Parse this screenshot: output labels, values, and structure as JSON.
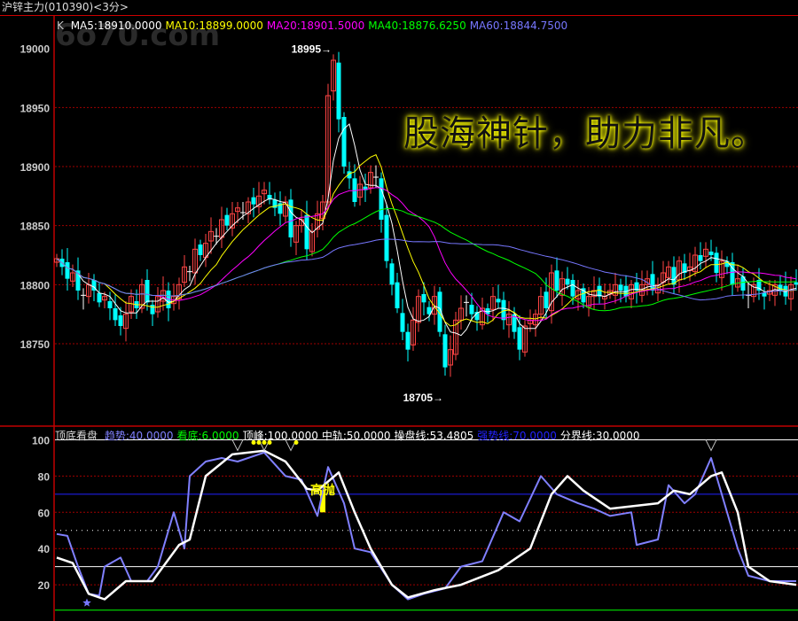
{
  "title": "沪锌主力(010390)<3分>",
  "watermark": "6o70.com",
  "main_header": {
    "k": "K",
    "items": [
      {
        "label": "MA5:18910.0000",
        "color": "#ffffff"
      },
      {
        "label": "MA10:18899.0000",
        "color": "#ffff00"
      },
      {
        "label": "MA20:18901.5000",
        "color": "#ff00ff"
      },
      {
        "label": "MA40:18876.6250",
        "color": "#00ff00"
      },
      {
        "label": "MA60:18844.7500",
        "color": "#7777ff"
      }
    ]
  },
  "price_axis": {
    "ticks": [
      "19000",
      "18950",
      "18900",
      "18850",
      "18800",
      "18750"
    ],
    "values": [
      19000,
      18950,
      18900,
      18850,
      18800,
      18750
    ],
    "range": [
      18681,
      19026
    ]
  },
  "annotations": {
    "high": "18995→",
    "high_value": 18995,
    "high_index": 52,
    "low": "18705→",
    "low_value": 18705,
    "low_index": 73
  },
  "slogan": "股海神针，助力非凡。",
  "colors": {
    "up": "#ff4444",
    "down": "#00ffff",
    "doji": "#ffffff",
    "grid": "#a00000",
    "axis": "#c00000"
  },
  "closes": [
    18822,
    18815,
    18805,
    18810,
    18795,
    18790,
    18800,
    18795,
    18785,
    18790,
    18780,
    18770,
    18765,
    18775,
    18790,
    18780,
    18800,
    18785,
    18775,
    18790,
    18795,
    18780,
    18790,
    18800,
    18815,
    18810,
    18830,
    18825,
    18835,
    18845,
    18840,
    18855,
    18850,
    18860,
    18865,
    18860,
    18870,
    18868,
    18875,
    18880,
    18872,
    18865,
    18860,
    18870,
    18840,
    18850,
    18855,
    18830,
    18845,
    18860,
    18870,
    18960,
    18990,
    18940,
    18900,
    18890,
    18870,
    18885,
    18880,
    18895,
    18890,
    18855,
    18820,
    18800,
    18780,
    18760,
    18745,
    18770,
    18790,
    18785,
    18775,
    18790,
    18760,
    18730,
    18745,
    18770,
    18780,
    18785,
    18775,
    18770,
    18780,
    18775,
    18790,
    18785,
    18770,
    18775,
    18760,
    18745,
    18765,
    18770,
    18775,
    18790,
    18780,
    18810,
    18795,
    18805,
    18800,
    18790,
    18795,
    18785,
    18790,
    18795,
    18790,
    18790,
    18795,
    18800,
    18795,
    18790,
    18800,
    18795,
    18800,
    18805,
    18795,
    18800,
    18810,
    18815,
    18800,
    18820,
    18810,
    18815,
    18825,
    18820,
    18830,
    18825,
    18810,
    18820,
    18815,
    18800,
    18805,
    18795,
    18790,
    18800,
    18795,
    18790,
    18795,
    18800,
    18795,
    18790,
    18800,
    18800
  ],
  "indicator": {
    "name": "顶底看盘",
    "params": [
      {
        "label": "趋势:40.0000",
        "color": "#8080ff"
      },
      {
        "label": "看底:6.0000",
        "color": "#00ff00"
      },
      {
        "label": "顶峰:100.0000",
        "color": "#ffffff"
      },
      {
        "label": "中轨:50.0000",
        "color": "#ffffff"
      },
      {
        "label": "操盘线:53.4805",
        "color": "#ffffff"
      },
      {
        "label": "强势线:70.0000",
        "color": "#2222ff"
      },
      {
        "label": "分界线:30.0000",
        "color": "#ffffff"
      }
    ],
    "ticks": [
      "100",
      "80",
      "60",
      "40",
      "20"
    ],
    "tick_values": [
      100,
      80,
      60,
      40,
      20
    ],
    "range": [
      0,
      100
    ],
    "signal_label": "高抛",
    "signal_index": 50,
    "signal_range": [
      60,
      72
    ],
    "trend": [
      [
        0,
        48
      ],
      [
        2,
        47
      ],
      [
        4,
        30
      ],
      [
        6,
        15
      ],
      [
        8,
        14
      ],
      [
        9,
        30
      ],
      [
        12,
        35
      ],
      [
        14,
        22
      ],
      [
        17,
        22
      ],
      [
        19,
        30
      ],
      [
        22,
        60
      ],
      [
        24,
        40
      ],
      [
        25,
        80
      ],
      [
        28,
        88
      ],
      [
        31,
        90
      ],
      [
        34,
        88
      ],
      [
        39,
        93
      ],
      [
        43,
        80
      ],
      [
        46,
        78
      ],
      [
        49,
        58
      ],
      [
        51,
        85
      ],
      [
        54,
        65
      ],
      [
        56,
        40
      ],
      [
        59,
        38
      ],
      [
        63,
        20
      ],
      [
        66,
        12
      ],
      [
        69,
        15
      ],
      [
        73,
        18
      ],
      [
        76,
        30
      ],
      [
        80,
        33
      ],
      [
        84,
        60
      ],
      [
        87,
        55
      ],
      [
        91,
        80
      ],
      [
        94,
        70
      ],
      [
        98,
        65
      ],
      [
        101,
        62
      ],
      [
        104,
        58
      ],
      [
        108,
        60
      ],
      [
        109,
        42
      ],
      [
        113,
        45
      ],
      [
        115,
        75
      ],
      [
        118,
        65
      ],
      [
        120,
        70
      ],
      [
        123,
        90
      ],
      [
        125,
        70
      ],
      [
        128,
        40
      ],
      [
        130,
        25
      ],
      [
        134,
        22
      ],
      [
        139,
        22
      ]
    ],
    "line": [
      [
        0,
        35
      ],
      [
        3,
        32
      ],
      [
        6,
        15
      ],
      [
        9,
        12
      ],
      [
        13,
        22
      ],
      [
        18,
        22
      ],
      [
        23,
        42
      ],
      [
        25,
        45
      ],
      [
        28,
        80
      ],
      [
        33,
        92
      ],
      [
        39,
        94
      ],
      [
        43,
        88
      ],
      [
        47,
        73
      ],
      [
        49,
        72
      ],
      [
        53,
        82
      ],
      [
        56,
        60
      ],
      [
        59,
        40
      ],
      [
        63,
        20
      ],
      [
        66,
        13
      ],
      [
        71,
        17
      ],
      [
        76,
        20
      ],
      [
        83,
        28
      ],
      [
        89,
        40
      ],
      [
        93,
        70
      ],
      [
        96,
        80
      ],
      [
        99,
        72
      ],
      [
        104,
        62
      ],
      [
        113,
        65
      ],
      [
        116,
        72
      ],
      [
        119,
        70
      ],
      [
        123,
        80
      ],
      [
        125,
        82
      ],
      [
        128,
        60
      ],
      [
        130,
        30
      ],
      [
        134,
        22
      ],
      [
        139,
        20
      ]
    ],
    "top_markers": [
      34,
      39,
      44,
      123
    ],
    "dot_markers": [
      37,
      38,
      39,
      40,
      45
    ],
    "star_index": 6
  }
}
